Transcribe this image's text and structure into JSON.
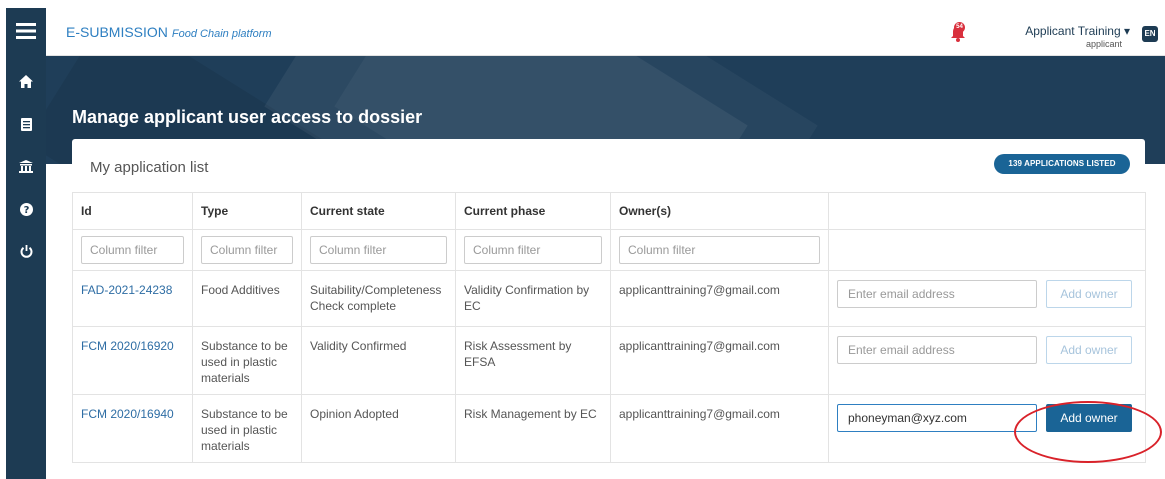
{
  "app": {
    "brand": "E-SUBMISSION",
    "tagline": "Food Chain platform"
  },
  "header": {
    "notification_count": "54",
    "user_name": "Applicant Training ▾",
    "user_role": "applicant",
    "language": "EN"
  },
  "sidebar": {
    "items": [
      {
        "icon": "menu-icon"
      },
      {
        "icon": "home-icon"
      },
      {
        "icon": "document-icon"
      },
      {
        "icon": "organization-icon"
      },
      {
        "icon": "help-icon"
      },
      {
        "icon": "power-icon"
      }
    ]
  },
  "page": {
    "title": "Manage applicant user access to dossier"
  },
  "list": {
    "title": "My application list",
    "count_badge": "139 APPLICATIONS LISTED",
    "columns": [
      "Id",
      "Type",
      "Current state",
      "Current phase",
      "Owner(s)",
      ""
    ],
    "filter_placeholder": "Column filter",
    "email_placeholder": "Enter email address",
    "add_owner_label": "Add owner",
    "rows": [
      {
        "id": "FAD-2021-24238",
        "type": "Food Additives",
        "state": "Suitability/Completeness Check complete",
        "phase": "Validity Confirmation by EC",
        "owners": "applicanttraining7@gmail.com",
        "email_value": ""
      },
      {
        "id": "FCM 2020/16920",
        "type": "Substance to be used in plastic materials",
        "state": "Validity Confirmed",
        "phase": "Risk Assessment by EFSA",
        "owners": "applicanttraining7@gmail.com",
        "email_value": ""
      },
      {
        "id": "FCM 2020/16940",
        "type": "Substance to be used in plastic materials",
        "state": "Opinion Adopted",
        "phase": "Risk Management by EC",
        "owners": "applicanttraining7@gmail.com",
        "email_value": "phoneyman@xyz.com"
      }
    ]
  },
  "colors": {
    "sidebar": "#1d3b53",
    "banner": "#1f3e59",
    "accent": "#2e7fc1",
    "primary_button": "#1a6496",
    "annotation": "#d9222a"
  }
}
